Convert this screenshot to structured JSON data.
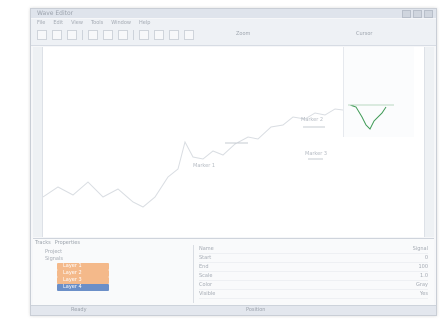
{
  "window": {
    "title": "Wave Editor"
  },
  "menu": [
    "File",
    "Edit",
    "View",
    "Tools",
    "Window",
    "Help"
  ],
  "toolbar": {
    "label_a": "Zoom",
    "label_b": "Cursor"
  },
  "waveform": {
    "series_color": "#d9dde2",
    "accent_color": "#3e9a55",
    "annotations": [
      "Marker 1",
      "Marker 2",
      "Marker 3"
    ]
  },
  "bottom_tabs": [
    "Tracks",
    "Properties"
  ],
  "tree": [
    {
      "label": "Project",
      "style": "normal"
    },
    {
      "label": "Signals",
      "style": "normal"
    },
    {
      "label": "Layer 1",
      "style": "orange"
    },
    {
      "label": "Layer 2",
      "style": "orange"
    },
    {
      "label": "Layer 3",
      "style": "orange"
    },
    {
      "label": "Layer 4",
      "style": "blue"
    }
  ],
  "properties": [
    {
      "name": "Name",
      "value": "Signal"
    },
    {
      "name": "Start",
      "value": "0"
    },
    {
      "name": "End",
      "value": "100"
    },
    {
      "name": "Scale",
      "value": "1.0"
    },
    {
      "name": "Color",
      "value": "Gray"
    },
    {
      "name": "Visible",
      "value": "Yes"
    }
  ],
  "status": {
    "left": "Ready",
    "right": "Position"
  }
}
